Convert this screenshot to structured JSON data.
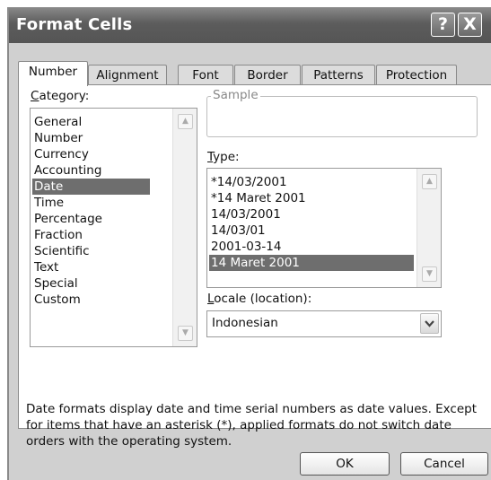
{
  "window": {
    "title": "Format Cells",
    "help_glyph": "?",
    "close_glyph": "X"
  },
  "tabs": [
    {
      "label": "Number",
      "active": true
    },
    {
      "label": "Alignment",
      "active": false
    },
    {
      "label": "Font",
      "active": false
    },
    {
      "label": "Border",
      "active": false
    },
    {
      "label": "Patterns",
      "active": false
    },
    {
      "label": "Protection",
      "active": false
    }
  ],
  "category": {
    "label_ul": "C",
    "label_rest": "ategory:",
    "items": [
      "General",
      "Number",
      "Currency",
      "Accounting",
      "Date",
      "Time",
      "Percentage",
      "Fraction",
      "Scientific",
      "Text",
      "Special",
      "Custom"
    ],
    "selected": "Date"
  },
  "sample": {
    "label": "Sample",
    "value": ""
  },
  "type": {
    "label_ul": "T",
    "label_rest": "ype:",
    "items": [
      "*14/03/2001",
      "*14 Maret 2001",
      "14/03/2001",
      "14/03/01",
      "2001-03-14",
      "14 Maret 2001"
    ],
    "selected_index": 5
  },
  "locale": {
    "label_ul": "L",
    "label_rest": "ocale (location):",
    "value": "Indonesian"
  },
  "description": "Date formats display date and time serial numbers as date values. Except for items that have an asterisk (*), applied formats do not switch date orders with the operating system.",
  "buttons": {
    "ok": "OK",
    "cancel": "Cancel"
  },
  "icons": {
    "scroll_up": "▲",
    "scroll_down": "▼",
    "dropdown": "chevron-down"
  }
}
